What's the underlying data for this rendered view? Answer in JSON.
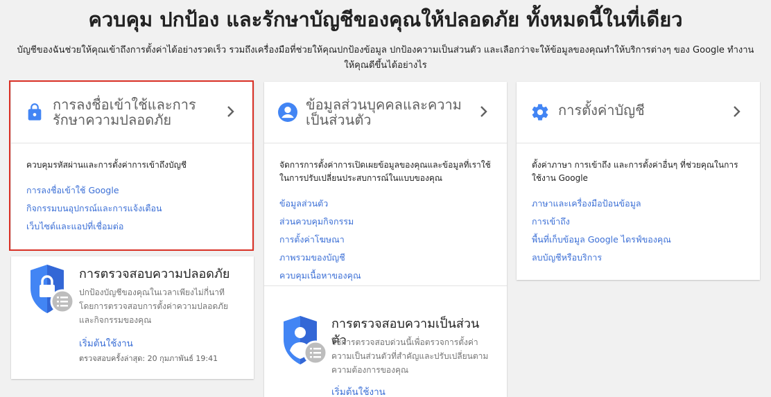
{
  "hero": {
    "title": "ควบคุม ปกป้อง และรักษาบัญชีของคุณให้ปลอดภัย ทั้งหมดนี้ในที่เดียว",
    "subtitle": "บัญชีของฉันช่วยให้คุณเข้าถึงการตั้งค่าได้อย่างรวดเร็ว รวมถึงเครื่องมือที่ช่วยให้คุณปกป้องข้อมูล ปกป้องความเป็นส่วนตัว และเลือกว่าจะให้ข้อมูลของคุณทำให้บริการต่างๆ ของ Google ทำงานให้คุณดีขึ้นได้อย่างไร"
  },
  "cards": {
    "signin": {
      "icon": "lock-icon",
      "title": "การลงชื่อเข้าใช้และการรักษาความปลอดภัย",
      "description": "ควบคุมรหัสผ่านและการตั้งค่าการเข้าถึงบัญชี",
      "links": [
        "การลงชื่อเข้าใช้ Google",
        "กิจกรรมบนอุปกรณ์และการแจ้งเตือน",
        "เว็บไซต์และแอปที่เชื่อมต่อ"
      ]
    },
    "privacy": {
      "icon": "person-icon",
      "title": "ข้อมูลส่วนบุคคลและความเป็นส่วนตัว",
      "description": "จัดการการตั้งค่าการเปิดเผยข้อมูลของคุณและข้อมูลที่เราใช้ในการปรับเปลี่ยนประสบการณ์ในแบบของคุณ",
      "links": [
        "ข้อมูลส่วนตัว",
        "ส่วนควบคุมกิจกรรม",
        "การตั้งค่าโฆษณา",
        "ภาพรวมของบัญชี",
        "ควบคุมเนื้อหาของคุณ"
      ]
    },
    "preferences": {
      "icon": "gear-icon",
      "title": "การตั้งค่าบัญชี",
      "description": "ตั้งค่าภาษา การเข้าถึง และการตั้งค่าอื่นๆ ที่ช่วยคุณในการใช้งาน Google",
      "links": [
        "ภาษาและเครื่องมือป้อนข้อมูล",
        "การเข้าถึง",
        "พื้นที่เก็บข้อมูล Google ไดรฟ์ของคุณ",
        "ลบบัญชีหรือบริการ"
      ]
    }
  },
  "security_checkup": {
    "title": "การตรวจสอบความปลอดภัย",
    "description": "ปกป้องบัญชีของคุณในเวลาเพียงไม่กี่นาทีโดยการตรวจสอบการตั้งค่าความปลอดภัยและกิจกรรมของคุณ",
    "link": "เริ่มต้นใช้งาน",
    "last_checked": "ตรวจสอบครั้งล่าสุด: 20 กุมภาพันธ์ 19:41"
  },
  "privacy_checkup": {
    "title": "การตรวจสอบความเป็นส่วนตัว",
    "description": "ใช้การตรวจสอบด่วนนี้เพื่อตรวจการตั้งค่าความเป็นส่วนตัวที่สำคัญและปรับเปลี่ยนตามความต้องการของคุณ",
    "link": "เริ่มต้นใช้งาน"
  },
  "colors": {
    "accent_blue": "#4285f4",
    "link_blue": "#3b6fd6",
    "highlight_red": "#d93025",
    "background": "#f1f1f1"
  }
}
